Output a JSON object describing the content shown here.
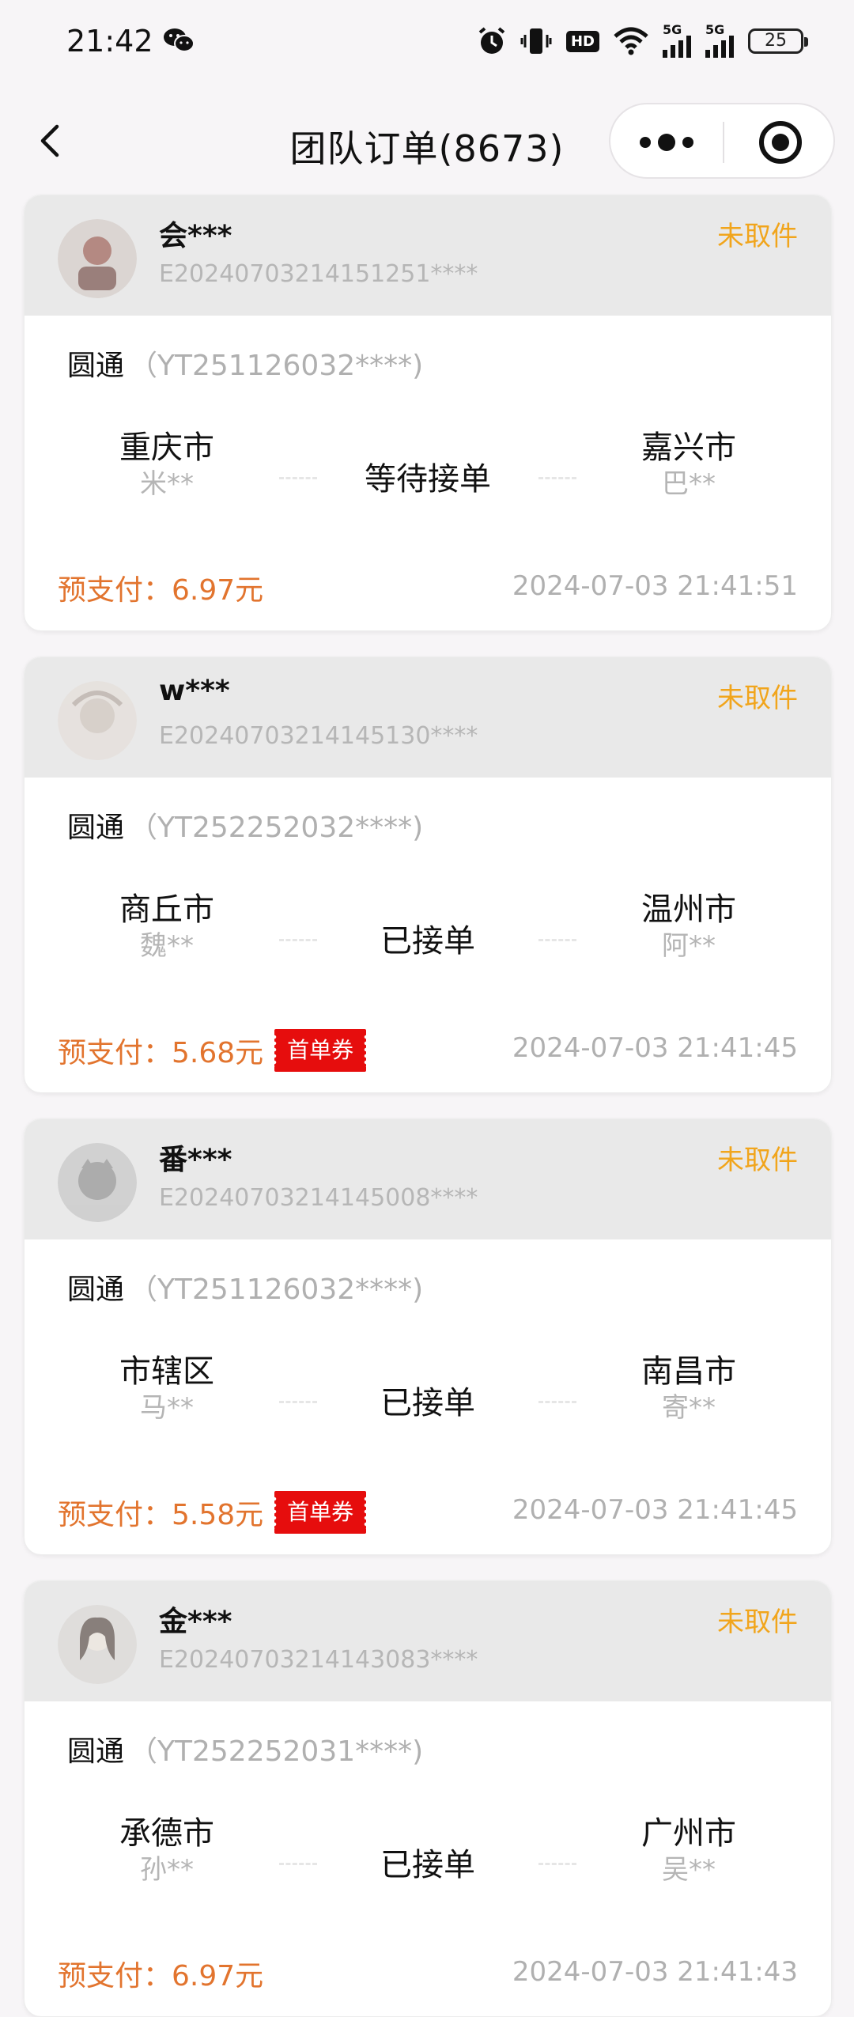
{
  "status_bar": {
    "time": "21:42",
    "network_1": "5G",
    "network_2": "5G",
    "hd_label": "HD",
    "battery": "25"
  },
  "nav": {
    "title": "团队订单(8673)"
  },
  "orders": [
    {
      "user": "会***",
      "order_no": "E20240703214151251****",
      "status": "未取件",
      "carrier": "圆通",
      "tracking": "（YT251126032****)",
      "from_city": "重庆市",
      "from_person": "米**",
      "route_status": "等待接单",
      "to_city": "嘉兴市",
      "to_person": "巴**",
      "prepay": "预支付：6.97元",
      "coupon": "",
      "time": "2024-07-03 21:41:51"
    },
    {
      "user": "w***",
      "order_no": "E20240703214145130****",
      "status": "未取件",
      "carrier": "圆通",
      "tracking": "（YT252252032****)",
      "from_city": "商丘市",
      "from_person": "魏**",
      "route_status": "已接单",
      "to_city": "温州市",
      "to_person": "阿**",
      "prepay": "预支付：5.68元",
      "coupon": "首单券",
      "time": "2024-07-03 21:41:45"
    },
    {
      "user": "番***",
      "order_no": "E20240703214145008****",
      "status": "未取件",
      "carrier": "圆通",
      "tracking": "（YT251126032****)",
      "from_city": "市辖区",
      "from_person": "马**",
      "route_status": "已接单",
      "to_city": "南昌市",
      "to_person": "寄**",
      "prepay": "预支付：5.58元",
      "coupon": "首单券",
      "time": "2024-07-03 21:41:45"
    },
    {
      "user": "金***",
      "order_no": "E20240703214143083****",
      "status": "未取件",
      "carrier": "圆通",
      "tracking": "（YT252252031****)",
      "from_city": "承德市",
      "from_person": "孙**",
      "route_status": "已接单",
      "to_city": "广州市",
      "to_person": "吴**",
      "prepay": "预支付：6.97元",
      "coupon": "",
      "time": "2024-07-03 21:41:43"
    }
  ],
  "colors": {
    "status": "#f1a51c",
    "prepay": "#e2742e",
    "coupon_bg": "#e60d0d",
    "muted_text": "#b0b0b0",
    "card_header": "#e9e9e9"
  },
  "icons": {
    "back": "chevron-left-icon",
    "more": "more-dots-icon",
    "close": "target-circle-icon",
    "chat": "wechat-icon",
    "alarm": "alarm-icon",
    "vibrate": "vibrate-icon",
    "wifi": "wifi-icon",
    "signal": "signal-icon",
    "battery": "battery-icon"
  }
}
